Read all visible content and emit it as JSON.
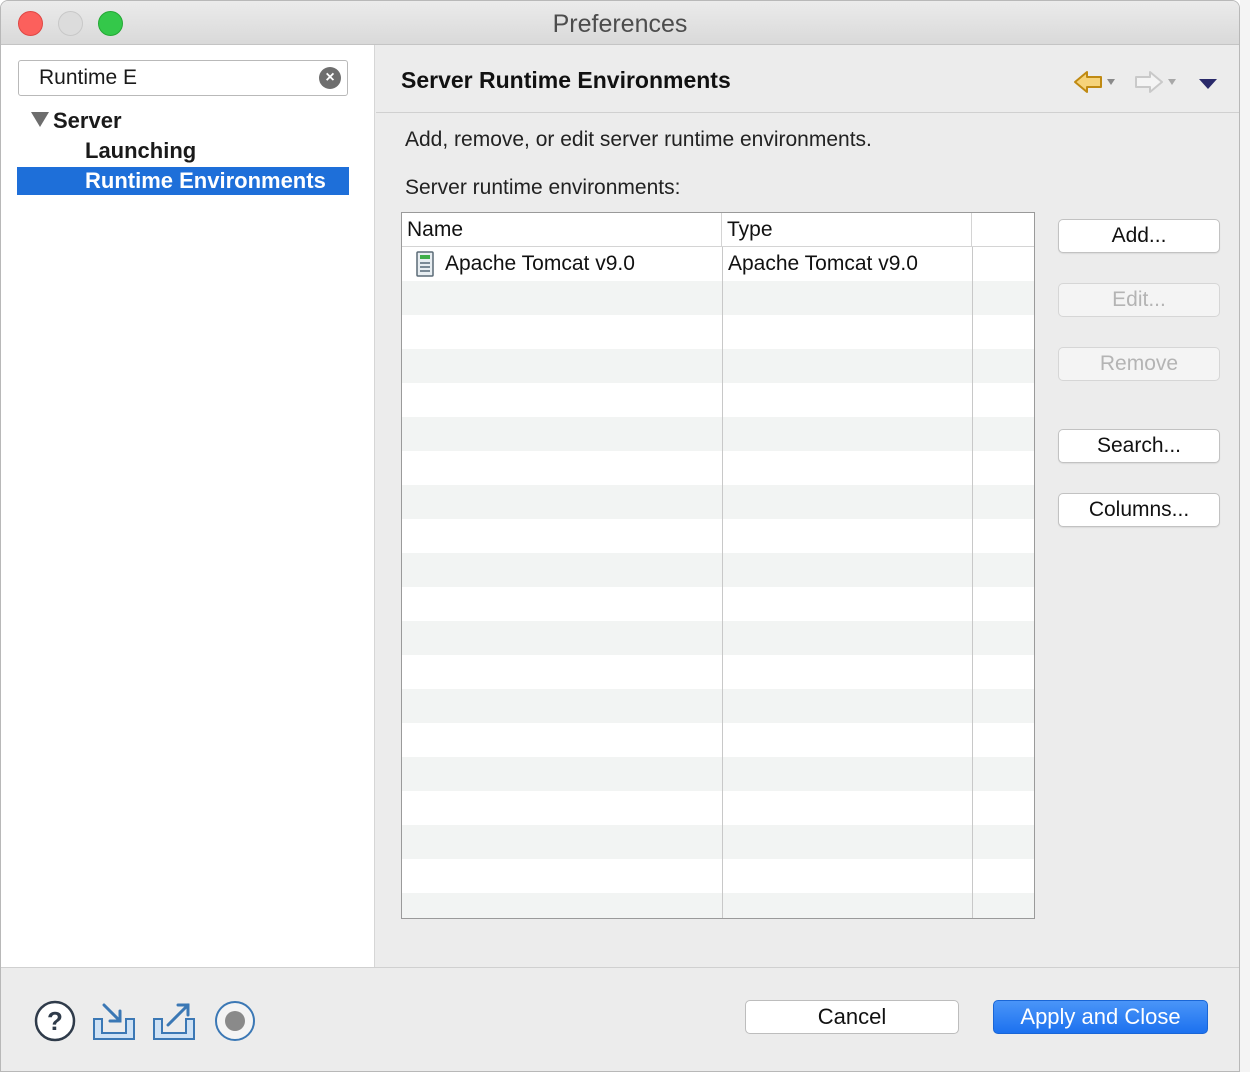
{
  "window": {
    "title": "Preferences"
  },
  "sidebar": {
    "filter_value": "Runtime E",
    "tree": [
      {
        "label": "Server",
        "level": 0,
        "expanded": true
      },
      {
        "label": "Launching",
        "level": 1
      },
      {
        "label": "Runtime Environments",
        "level": 1,
        "selected": true
      }
    ]
  },
  "page": {
    "title": "Server Runtime Environments",
    "description": "Add, remove, or edit server runtime environments.",
    "list_label": "Server runtime environments:"
  },
  "table": {
    "columns": [
      "Name",
      "Type"
    ],
    "rows": [
      {
        "name": "Apache Tomcat v9.0",
        "type": "Apache Tomcat v9.0",
        "icon": "server-icon"
      }
    ]
  },
  "buttons": {
    "add": "Add...",
    "edit": "Edit...",
    "remove": "Remove",
    "search": "Search...",
    "columns": "Columns..."
  },
  "footer": {
    "cancel": "Cancel",
    "apply_close": "Apply and Close",
    "icons": [
      "help-icon",
      "import-icon",
      "export-icon",
      "record-icon"
    ]
  },
  "colors": {
    "selection": "#1e6fd9",
    "primary_button": "#1c71ef",
    "nav_back": "#e0a020"
  }
}
